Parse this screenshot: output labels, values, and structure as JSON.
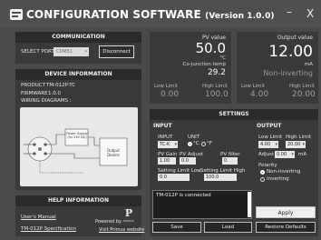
{
  "window": {
    "title": "CONFIGURATION SOFTWARE",
    "version": "(Version 1.0.0)",
    "minimize": "–",
    "close": "X"
  },
  "communication": {
    "header": "COMMUNICATION",
    "port_label": "SELECT PORT",
    "port_value": "COM51",
    "disconnect": "Disconnect"
  },
  "device_info": {
    "header": "DEVICE INFORMATION",
    "product_label": "PRODUCT",
    "product_value": "TM-012P-TC",
    "firmware_label": "FIRMWARE",
    "firmware_value": "1.0.0",
    "wiring_label": "WIRING DIAGRAMS :",
    "diagram_labels": {
      "power": "Power Supply (Vs 24V DC)",
      "output": "Output Device"
    }
  },
  "help": {
    "header": "HELP INFORMATION",
    "users_manual": "User's Manual",
    "spec": "TM-012P Specification",
    "powered_by": "Powered by",
    "brand": "PRIMUS",
    "website": "Visit Primus website"
  },
  "pv": {
    "title": "PV value",
    "value": "50.0",
    "unit": "°C",
    "cj_label": "Co-junction temp",
    "cj_value": "29.2",
    "low_label": "Low Limit",
    "low_value": "0.00",
    "high_label": "High Limit",
    "high_value": "100.0"
  },
  "output": {
    "title": "Output value",
    "value": "12.00",
    "unit": "mA",
    "mode": "Non-inverting",
    "low_label": "Low Limit",
    "low_value": "4.00",
    "high_label": "High Limit",
    "high_value": "20.00"
  },
  "settings": {
    "header": "SETTINGS",
    "input_header": "INPUT",
    "output_header": "OUTPUT",
    "input_label": "INPUT",
    "input_value": "TC-K",
    "unit_label": "UNIT",
    "unit_c": "°C",
    "unit_f": "°F",
    "pv_gain_label": "PV Gain",
    "pv_gain_value": "1.00",
    "pv_adjust_label": "PV Adjust",
    "pv_adjust_value": "0.0",
    "pv_filter_label": "PV filter",
    "pv_filter_value": "0",
    "set_low_label": "Setting Limit Low",
    "set_low_value": "0.0",
    "set_high_label": "Setting Limit High",
    "set_high_value": "100.0",
    "out_low_label": "Low Limit",
    "out_low_value": "4.00",
    "out_high_label": "High Limit",
    "out_high_value": "20.00",
    "adjust_label": "Adjust",
    "adjust_value": "0.00",
    "adjust_unit": "mA",
    "polarity_label": "Polarity",
    "non_inverting": "Non-inverting",
    "inverting": "Inverting",
    "console_text": "TM-012P is connected",
    "apply": "Apply",
    "save": "Save",
    "load": "Load",
    "restore": "Restore Defaults"
  }
}
